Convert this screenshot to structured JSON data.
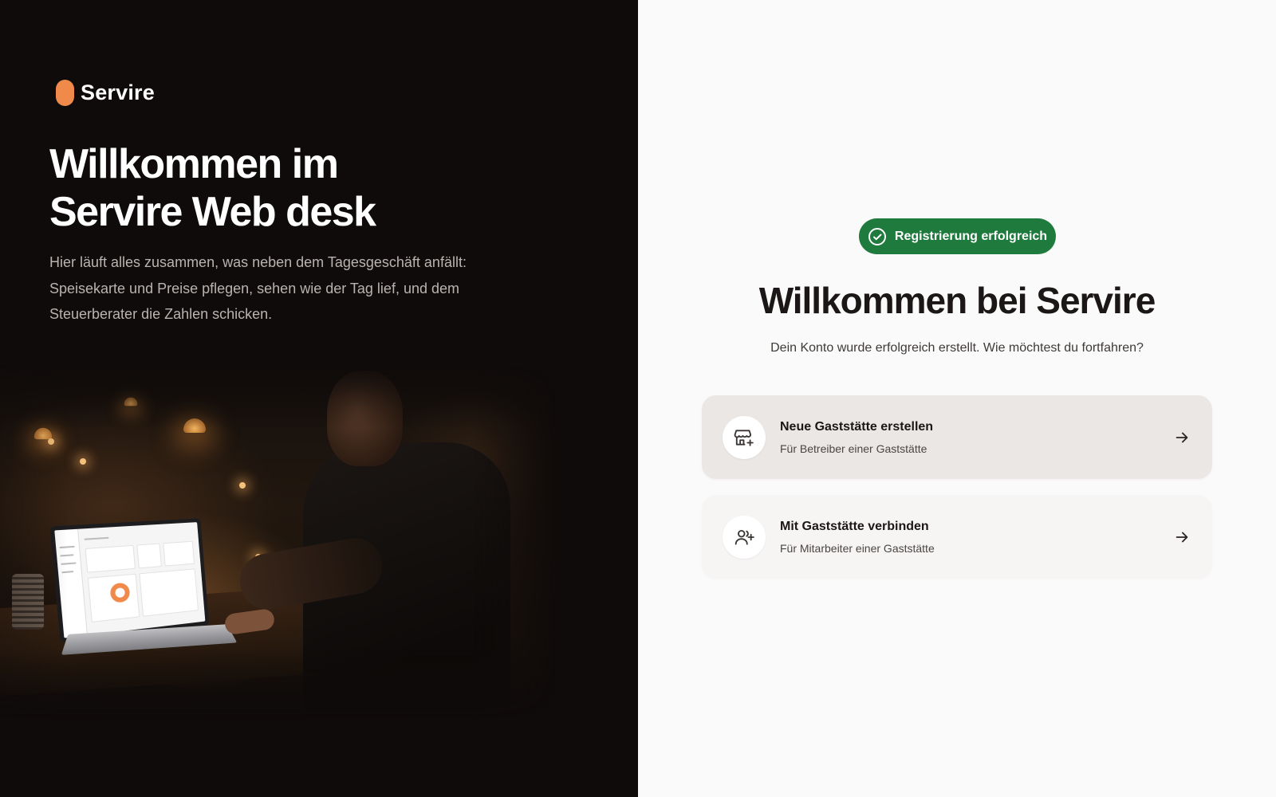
{
  "brand": {
    "name": "Servire",
    "accent": "#f08a4b"
  },
  "hero": {
    "title_line1": "Willkommen im",
    "title_line2": "Servire Web desk",
    "description": "Hier läuft alles zusammen, was neben dem Tagesgeschäft anfällt: Speisekarte und Preise pflegen, sehen wie der Tag lief, und dem Steuerberater die Zahlen schicken."
  },
  "status_badge": {
    "label": "Registrierung erfolgreich",
    "icon": "check-circle-icon",
    "color": "#1f7a3e"
  },
  "main": {
    "title": "Willkommen bei Servire",
    "subtitle": "Dein Konto wurde erfolgreich erstellt. Wie möchtest du fortfahren?"
  },
  "options": [
    {
      "title": "Neue Gaststätte erstellen",
      "description": "Für Betreiber einer Gaststätte",
      "icon": "store-plus-icon"
    },
    {
      "title": "Mit Gaststätte verbinden",
      "description": "Für Mitarbeiter einer Gaststätte",
      "icon": "users-plus-icon"
    }
  ]
}
